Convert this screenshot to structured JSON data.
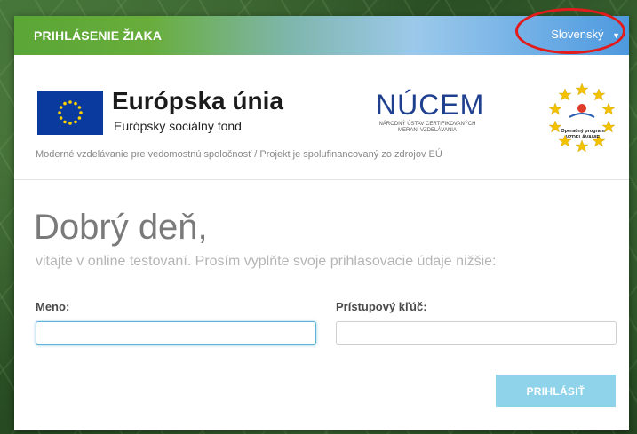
{
  "header": {
    "title": "PRIHLÁSENIE ŽIAKA",
    "language_selected": "Slovenský",
    "accent_gradient": [
      "#5aa636",
      "#9cc9ea",
      "#4d99de"
    ]
  },
  "annotation": {
    "color": "#e21b1b"
  },
  "logos": {
    "eu_title": "Európska únia",
    "eu_subtitle": "Európsky sociálny fond",
    "nucem_name": "NÚCEM",
    "nucem_subtitle": "NÁRODNÝ ÚSTAV CERTIFIKOVANÝCH MERANÍ VZDELÁVANIA",
    "op_subtitle_line1": "Operačný program",
    "op_subtitle_line2": "VZDELÁVANIE"
  },
  "tagline": "Moderné vzdelávanie pre vedomostnú spoločnosť  /  Projekt je spolufinancovaný zo zdrojov EÚ",
  "form": {
    "greeting": "Dobrý deň,",
    "lead": "vitajte v online testovaní. Prosím vyplňte svoje prihlasovacie údaje nižšie:",
    "name_label": "Meno:",
    "name_value": "",
    "key_label": "Prístupový kľúč:",
    "key_value": "",
    "submit_label": "PRIHLÁSIŤ"
  },
  "colors": {
    "button": "#8fd3ea",
    "focus_border": "#5fb3d9",
    "eu_blue": "#0a3a9e",
    "eu_star": "#ffd200",
    "nucem_blue": "#1f3f8f"
  }
}
